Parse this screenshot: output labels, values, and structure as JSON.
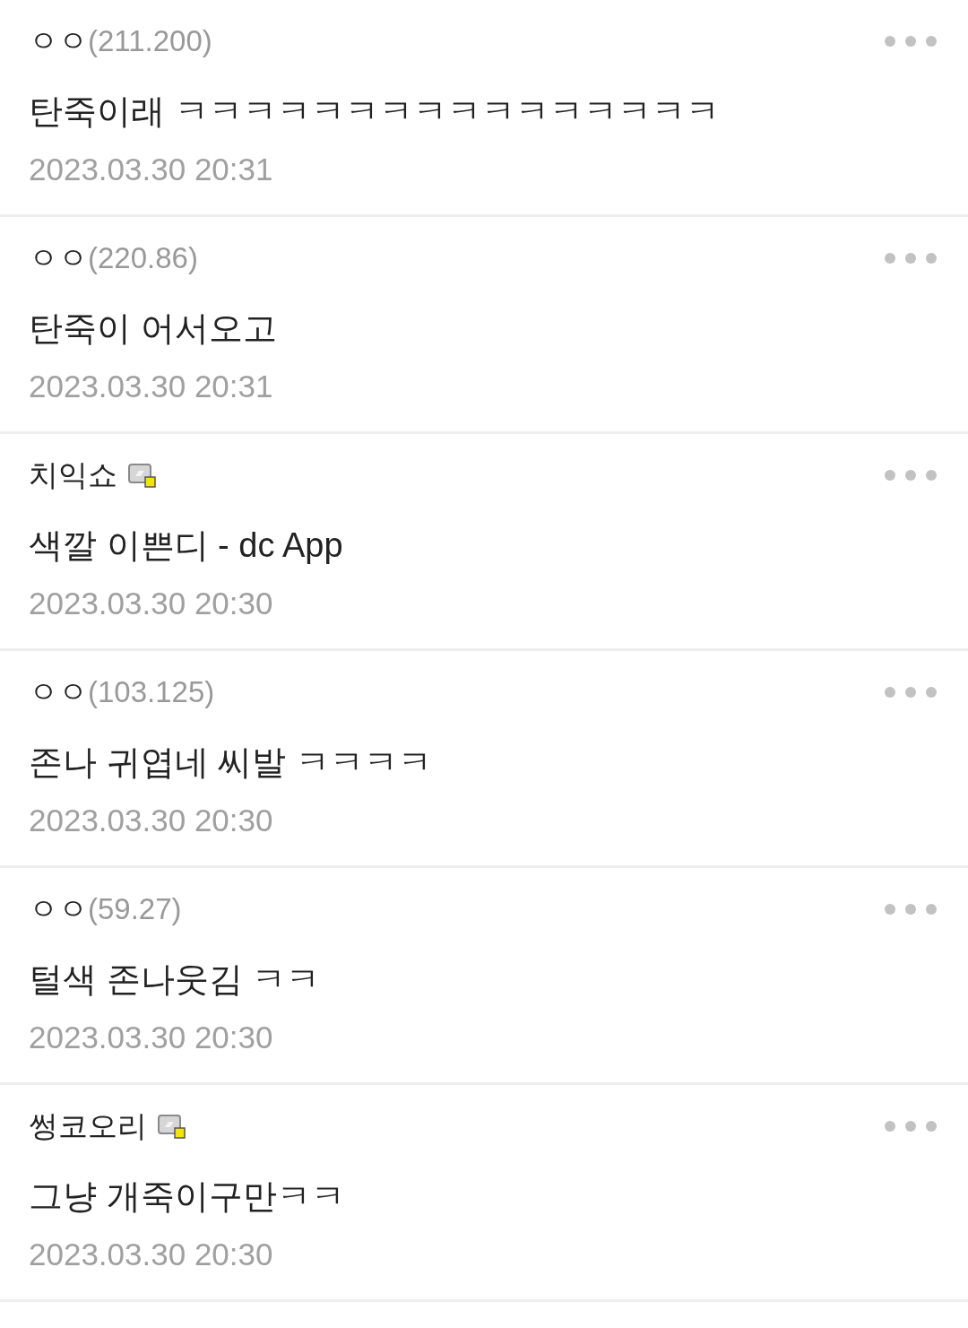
{
  "comments": [
    {
      "kind": "guest",
      "name": "ㅇㅇ",
      "ip": "(211.200)",
      "text": "탄죽이래 ㅋㅋㅋㅋㅋㅋㅋㅋㅋㅋㅋㅋㅋㅋㅋㅋ",
      "date": "2023.03.30 20:31"
    },
    {
      "kind": "guest",
      "name": "ㅇㅇ",
      "ip": "(220.86)",
      "text": "탄죽이 어서오고",
      "date": "2023.03.30 20:31"
    },
    {
      "kind": "member",
      "name": "치익쇼",
      "text": "색깔 이쁜디 - dc App",
      "date": "2023.03.30 20:30"
    },
    {
      "kind": "guest",
      "name": "ㅇㅇ",
      "ip": "(103.125)",
      "text": "존나 귀엽네 씨발 ㅋㅋㅋㅋ",
      "date": "2023.03.30 20:30"
    },
    {
      "kind": "guest",
      "name": "ㅇㅇ",
      "ip": "(59.27)",
      "text": "털색 존나웃김 ㅋㅋ",
      "date": "2023.03.30 20:30"
    },
    {
      "kind": "member",
      "name": "썽코오리",
      "text": "그냥 개죽이구만ㅋㅋ",
      "date": "2023.03.30 20:30"
    }
  ]
}
